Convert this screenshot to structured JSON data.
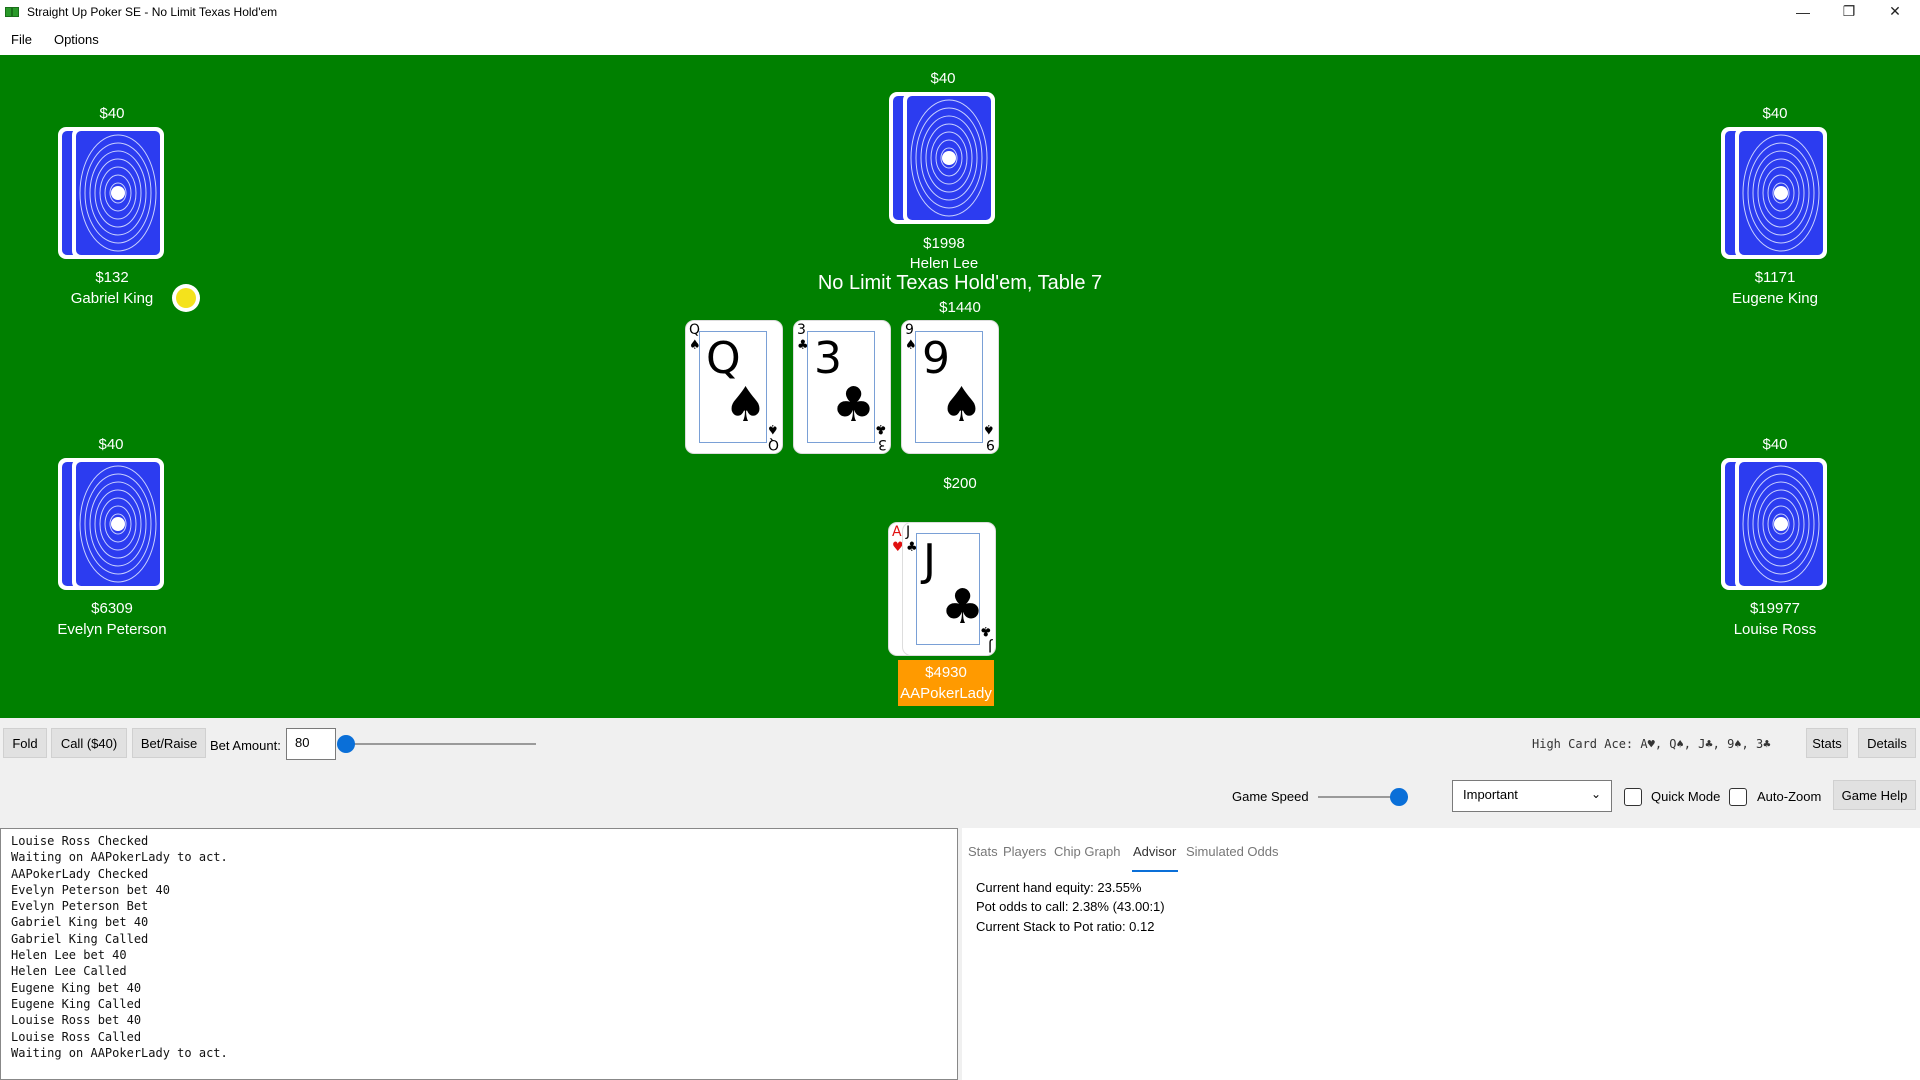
{
  "window": {
    "title": "Straight Up Poker SE - No Limit Texas Hold'em",
    "minimize": "—",
    "maximize": "❐",
    "close": "✕"
  },
  "menu": [
    "File",
    "Options"
  ],
  "table": {
    "title": "No Limit Texas Hold'em, Table 7",
    "pot": "$1440",
    "my_bet": "$200",
    "community": [
      {
        "rank": "Q",
        "suit": "♠"
      },
      {
        "rank": "3",
        "suit": "♣"
      },
      {
        "rank": "9",
        "suit": "♠"
      }
    ],
    "players": {
      "gabriel": {
        "name": "Gabriel King",
        "stack": "$132",
        "bet": "$40"
      },
      "helen": {
        "name": "Helen Lee",
        "stack": "$1998",
        "bet": "$40"
      },
      "eugene": {
        "name": "Eugene King",
        "stack": "$1171",
        "bet": "$40"
      },
      "evelyn": {
        "name": "Evelyn Peterson",
        "stack": "$6309",
        "bet": "$40"
      },
      "louise": {
        "name": "Louise Ross",
        "stack": "$19977",
        "bet": "$40"
      },
      "me": {
        "name": "AAPokerLady",
        "stack": "$4930",
        "cards": [
          {
            "rank": "A",
            "suit": "♥",
            "color": "#e01010"
          },
          {
            "rank": "J",
            "suit": "♣",
            "color": "#000000"
          }
        ]
      }
    },
    "colors": {
      "felt": "#008000",
      "card_back": "#2c3cf0",
      "me_highlight": "#ff9a00",
      "dealer": "#f4e21c"
    }
  },
  "controls": {
    "fold": "Fold",
    "call": "Call ($40)",
    "bet_raise": "Bet/Raise",
    "bet_amount_label": "Bet Amount:",
    "bet_amount_value": "80",
    "hand_hint": "High Card Ace: A♥, Q♠, J♣, 9♠, 3♣",
    "stats_btn": "Stats",
    "details_btn": "Details",
    "game_speed_label": "Game Speed",
    "game_speed_level": 0.9,
    "bet_slider_level": 0.0,
    "verbosity": "Important",
    "quick_mode": "Quick Mode",
    "auto_zoom": "Auto-Zoom",
    "game_help": "Game Help"
  },
  "log": [
    "Louise Ross Checked",
    "Waiting on AAPokerLady to act.",
    "AAPokerLady Checked",
    "Evelyn Peterson bet 40",
    "Evelyn Peterson Bet",
    "Gabriel King bet 40",
    "Gabriel King Called",
    "Helen Lee bet 40",
    "Helen Lee Called",
    "Eugene King bet 40",
    "Eugene King Called",
    "Louise Ross bet 40",
    "Louise Ross Called",
    "Waiting on AAPokerLady to act."
  ],
  "tabs": [
    "Stats",
    "Players",
    "Chip Graph",
    "Advisor",
    "Simulated Odds"
  ],
  "active_tab": "Advisor",
  "advisor": {
    "equity": "Current hand equity: 23.55%",
    "pot_odds": "Pot odds to call: 2.38% (43.00:1)",
    "spr": "Current Stack to Pot ratio: 0.12"
  }
}
